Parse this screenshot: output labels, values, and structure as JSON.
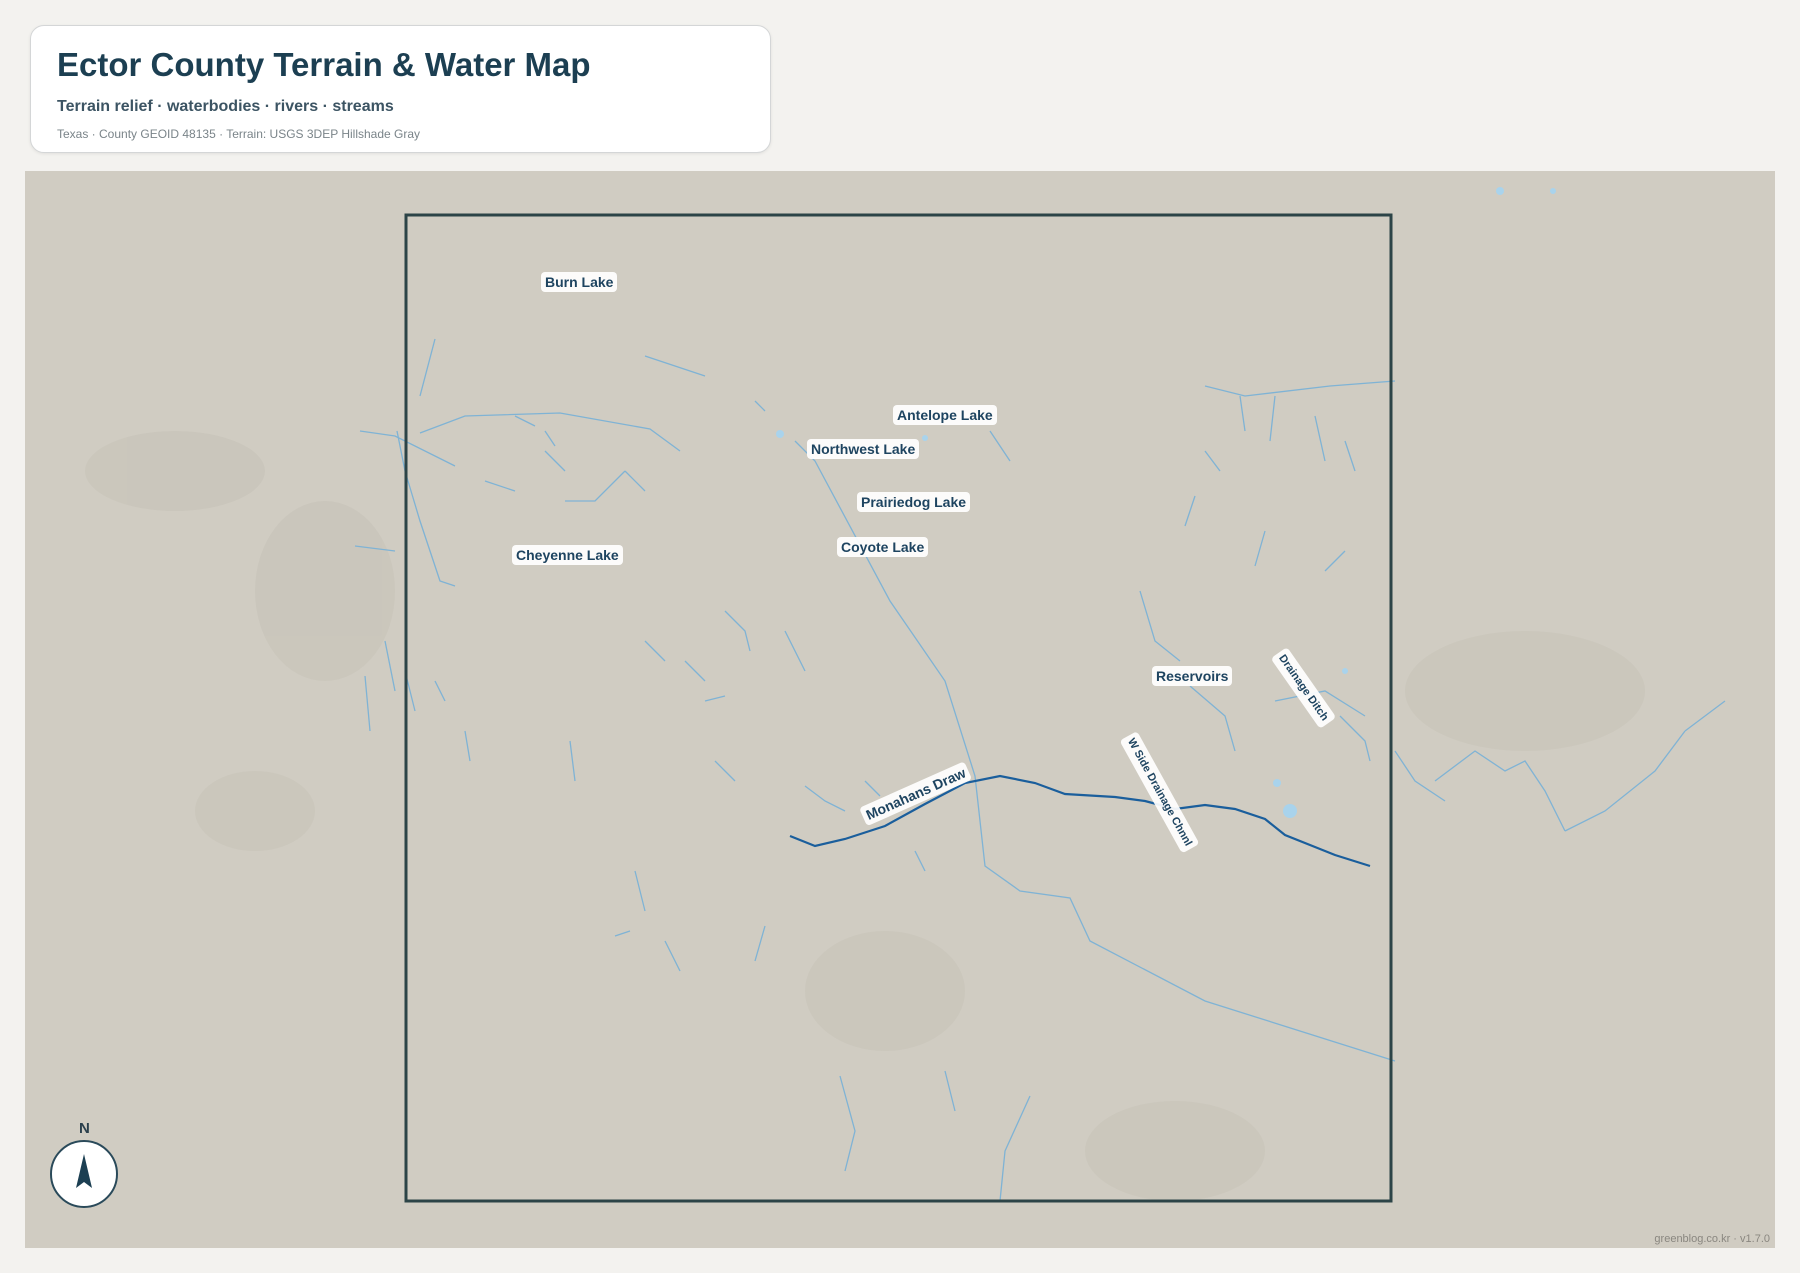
{
  "header": {
    "title": "Ector County Terrain & Water Map",
    "subtitle": "Terrain relief · waterbodies · rivers · streams",
    "source": "Texas · County GEOID 48135 · Terrain: USGS 3DEP Hillshade Gray"
  },
  "map": {
    "labels": {
      "burn_lake": "Burn Lake",
      "antelope_lake": "Antelope Lake",
      "northwest_lake": "Northwest Lake",
      "prairiedog_lake": "Prairiedog Lake",
      "coyote_lake": "Coyote Lake",
      "cheyenne_lake": "Cheyenne Lake",
      "reservoirs": "Reservoirs",
      "drainage_ditch": "Drainage Ditch",
      "w_side_drainage": "W Side Drainage Chnnl",
      "monahans_draw": "Monahans Draw"
    },
    "colors": {
      "terrain": "#d0ccc2",
      "boundary": "#2c4447",
      "river": "#1a5e9c",
      "stream": "#7fb3d5",
      "waterbody": "#a9d3ec"
    }
  },
  "compass": {
    "letter": "N",
    "icon": "north-arrow-icon"
  },
  "credit": "greenblog.co.kr · v1.7.0"
}
